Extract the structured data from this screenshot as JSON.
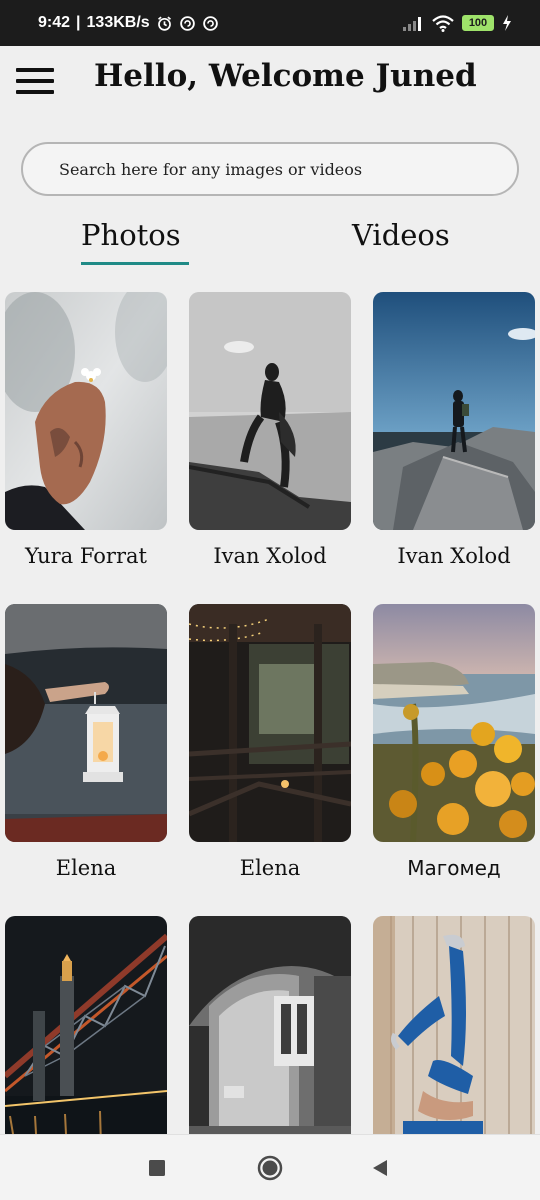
{
  "status_bar": {
    "time": "9:42",
    "speed": "133KB/s",
    "battery": "100",
    "icons": [
      "alarm-icon",
      "sync-icon",
      "sync-icon",
      "signal-icon",
      "wifi-icon",
      "battery-icon",
      "charging-icon"
    ]
  },
  "header": {
    "title": "Hello, Welcome Juned",
    "menu_icon": "hamburger-menu-icon"
  },
  "search": {
    "placeholder": "Search here for any images or videos",
    "value": ""
  },
  "tabs": [
    {
      "label": "Photos",
      "active": true
    },
    {
      "label": "Videos",
      "active": false
    }
  ],
  "accent_color": "#1f8a86",
  "gallery": [
    {
      "author": "Yura Forrat",
      "image": "hand holding small white flower"
    },
    {
      "author": "Ivan Xolod",
      "image": "woman on rocks black and white"
    },
    {
      "author": "Ivan Xolod",
      "image": "person standing on concrete blocks by sea"
    },
    {
      "author": "Elena",
      "image": "hand holding lantern by lake"
    },
    {
      "author": "Elena",
      "image": "dark porch with string lights"
    },
    {
      "author": "Магомед",
      "image": "yellow flowers and sea cliffs"
    },
    {
      "author": "",
      "image": "lit bridge at night"
    },
    {
      "author": "",
      "image": "arched corridor black and white"
    },
    {
      "author": "",
      "image": "person doing handstand against wooden wall"
    }
  ],
  "nav_bar": {
    "buttons": [
      "recents-square-icon",
      "home-circle-icon",
      "back-triangle-icon"
    ]
  }
}
